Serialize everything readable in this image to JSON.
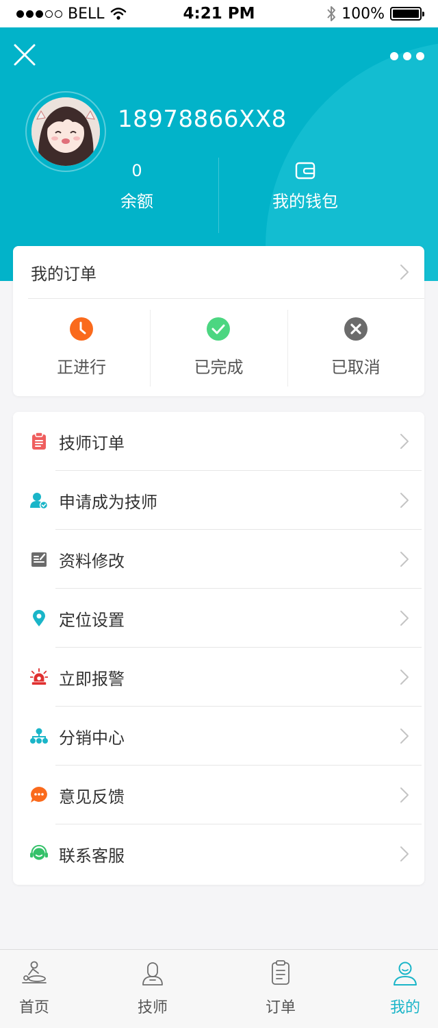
{
  "status_bar": {
    "carrier": "BELL",
    "time": "4:21 PM",
    "battery": "100%",
    "battery_level": 1.0
  },
  "header": {
    "phone": "18978866XX8",
    "balance_value": "0",
    "balance_label": "余额",
    "wallet_label": "我的钱包",
    "close_icon": "close-icon",
    "more_icon": "more-icon"
  },
  "orders": {
    "title": "我的订单",
    "statuses": [
      {
        "label": "正进行",
        "icon": "clock-icon",
        "color": "#fa6a1c"
      },
      {
        "label": "已完成",
        "icon": "check-circle-icon",
        "color": "#4cd681"
      },
      {
        "label": "已取消",
        "icon": "cancel-circle-icon",
        "color": "#6b6b6b"
      }
    ]
  },
  "menu": {
    "items": [
      {
        "label": "技师订单",
        "icon": "clipboard-icon",
        "color": "#ef5e5e"
      },
      {
        "label": "申请成为技师",
        "icon": "user-verified-icon",
        "color": "#1ab5c8"
      },
      {
        "label": "资料修改",
        "icon": "edit-profile-icon",
        "color": "#6b6b6b"
      },
      {
        "label": "定位设置",
        "icon": "location-pin-icon",
        "color": "#1ab5c8"
      },
      {
        "label": "立即报警",
        "icon": "alarm-siren-icon",
        "color": "#e03030"
      },
      {
        "label": "分销中心",
        "icon": "org-chart-icon",
        "color": "#1ab5c8"
      },
      {
        "label": "意见反馈",
        "icon": "feedback-bubble-icon",
        "color": "#fa6a1c"
      },
      {
        "label": "联系客服",
        "icon": "customer-service-icon",
        "color": "#35c16a"
      }
    ]
  },
  "tabs": [
    {
      "label": "首页",
      "icon": "home-massage-icon",
      "active": false
    },
    {
      "label": "技师",
      "icon": "technician-icon",
      "active": false
    },
    {
      "label": "订单",
      "icon": "order-list-icon",
      "active": false
    },
    {
      "label": "我的",
      "icon": "profile-icon",
      "active": true
    }
  ],
  "colors": {
    "accent": "#02b3c9",
    "accent_light": "#13bdd1",
    "tab_active": "#1ab5c8",
    "background": "#f5f5f7"
  }
}
